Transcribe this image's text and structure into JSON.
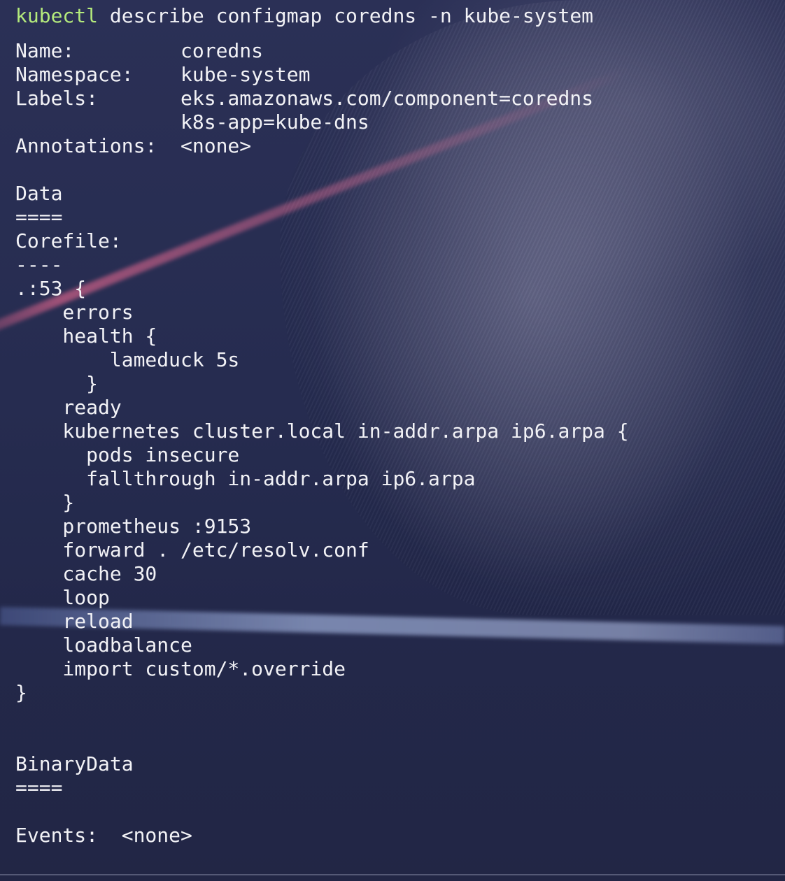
{
  "command": {
    "program": "kubectl",
    "args": "describe configmap coredns -n kube-system"
  },
  "output_lines": [
    "Name:         coredns",
    "Namespace:    kube-system",
    "Labels:       eks.amazonaws.com/component=coredns",
    "              k8s-app=kube-dns",
    "Annotations:  <none>",
    "",
    "Data",
    "====",
    "Corefile:",
    "----",
    ".:53 {",
    "    errors",
    "    health {",
    "        lameduck 5s",
    "      }",
    "    ready",
    "    kubernetes cluster.local in-addr.arpa ip6.arpa {",
    "      pods insecure",
    "      fallthrough in-addr.arpa ip6.arpa",
    "    }",
    "    prometheus :9153",
    "    forward . /etc/resolv.conf",
    "    cache 30",
    "    loop",
    "    reload",
    "    loadbalance",
    "    import custom/*.override",
    "}",
    "",
    "",
    "BinaryData",
    "====",
    "",
    "Events:  <none>"
  ],
  "colors": {
    "command_accent": "#b4ea7c",
    "text": "#f2f2f6",
    "background": "#242a4c"
  }
}
